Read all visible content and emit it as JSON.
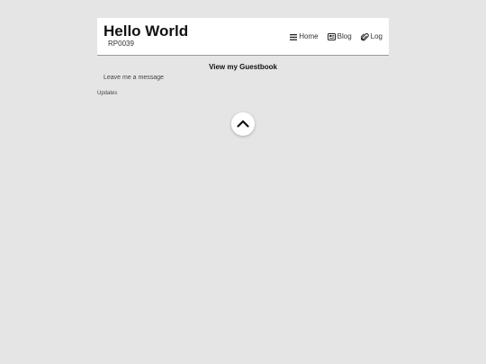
{
  "header": {
    "title": "Hello World",
    "subtitle": "RP0039",
    "nav": [
      {
        "label": "Home",
        "icon": "menu-icon"
      },
      {
        "label": "Blog",
        "icon": "newspaper-icon"
      },
      {
        "label": "Log",
        "icon": "paperclip-icon"
      }
    ]
  },
  "main": {
    "heading": "View my Guestbook",
    "message_link": "Leave me a message",
    "updates_label": "Updates"
  },
  "scroll_top": {
    "icon": "chevron-up-icon"
  },
  "colors": {
    "background": "#e5e5e5",
    "header_background": "#ffffff",
    "header_border": "#9a9a9a"
  }
}
